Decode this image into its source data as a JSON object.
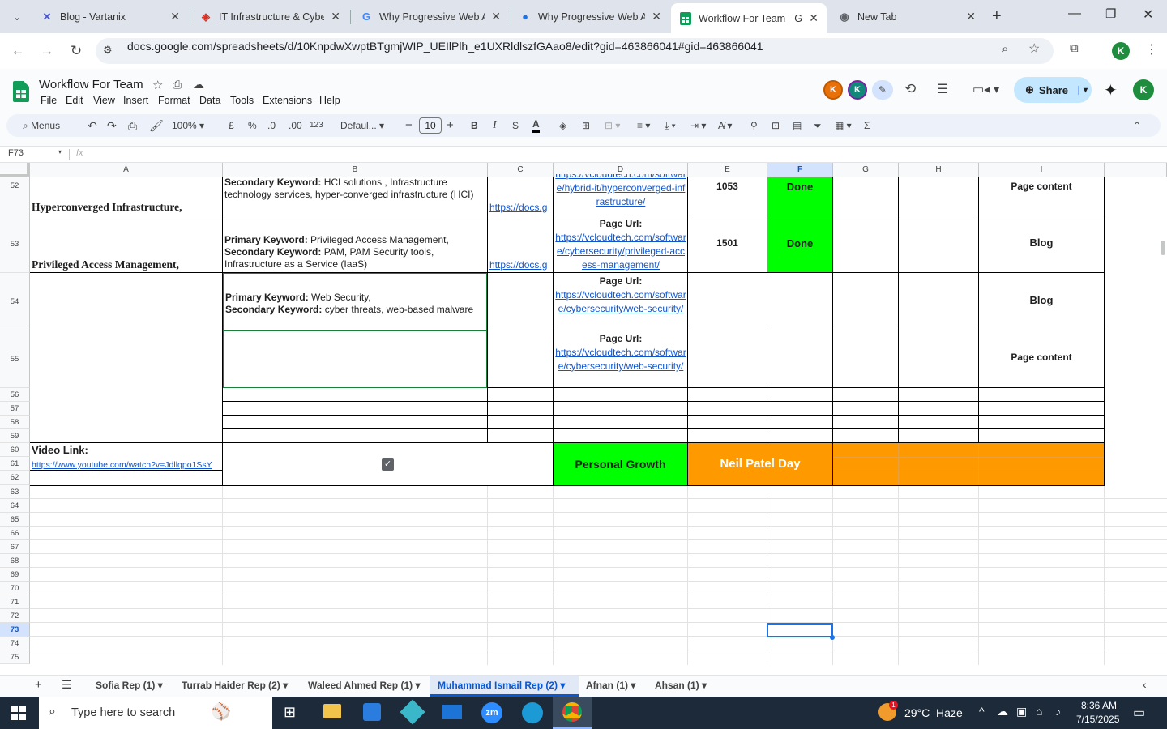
{
  "browser": {
    "tabs": [
      {
        "label": "Blog - Vartanix",
        "icon": "vartanix-icon",
        "color": "#4a56d8"
      },
      {
        "label": "IT Infrastructure & Cybe",
        "icon": "vcloud-icon",
        "color": "#d93025"
      },
      {
        "label": "Why Progressive Web A",
        "icon": "google-icon",
        "color": "#4285f4"
      },
      {
        "label": "Why Progressive Web A",
        "icon": "gemini-icon",
        "color": "#1a73e8"
      },
      {
        "label": "Workflow For Team - Go",
        "icon": "sheets-icon",
        "color": "#0f9d58",
        "active": true
      },
      {
        "label": "New Tab",
        "icon": "chrome-icon",
        "color": "#5f6368"
      }
    ],
    "url": "docs.google.com/spreadsheets/d/10KnpdwXwptBTgmjWIP_UEIlPlh_e1UXRldlszfGAao8/edit?gid=463866041#gid=463866041"
  },
  "sheets": {
    "title": "Workflow For Team",
    "menus": [
      "File",
      "Edit",
      "View",
      "Insert",
      "Format",
      "Data",
      "Tools",
      "Extensions",
      "Help"
    ],
    "share_label": "Share",
    "avatar_letter": "K",
    "toolbar": {
      "search": "Menus",
      "zoom": "100%",
      "currency": "£",
      "percent": "%",
      "dec_less": ".0",
      "dec_more": ".00",
      "numfmt": "123",
      "font": "Defaul...",
      "font_size": "10"
    },
    "name_box": "F73",
    "fx": "fx"
  },
  "columns": [
    "A",
    "B",
    "C",
    "D",
    "E",
    "F",
    "G",
    "H",
    "I"
  ],
  "row_numbers": [
    "52",
    "53",
    "54",
    "55",
    "56",
    "57",
    "58",
    "59",
    "60",
    "61",
    "62",
    "63",
    "64",
    "65",
    "66",
    "67",
    "68",
    "69",
    "70",
    "71",
    "72",
    "73",
    "74",
    "75"
  ],
  "rows": {
    "r52": {
      "a": "Hyperconverged Infrastructure,",
      "b_bold": "Secondary Keyword:",
      "b_text": " HCI solutions , Infrastructure technology services, hyper-converged infrastructure (HCI)",
      "c": "https://docs.g",
      "d": "https://vcloudtech.com/software/hybrid-it/hyperconverged-infrastructure/",
      "e": "1053",
      "f": "Done",
      "i": "Page content"
    },
    "r53": {
      "a": "Privileged Access Management,",
      "b_bold1": "Primary Keyword:",
      "b_text1": " Privileged Access Management,",
      "b_bold2": "Secondary Keyword:",
      "b_text2": " PAM, PAM Security tools, Infrastructure as a Service (IaaS)",
      "c": "https://docs.g",
      "d_label": "Page Url:",
      "d": "https://vcloudtech.com/software/cybersecurity/privileged-access-management/",
      "e": "1501",
      "f": "Done",
      "i": "Blog"
    },
    "r54": {
      "b_bold1": "Primary Keyword:",
      "b_text1": " Web Security,",
      "b_bold2": "Secondary Keyword:",
      "b_text2": " cyber threats, web-based malware",
      "d_label": "Page Url:",
      "d": "https://vcloudtech.com/software/cybersecurity/web-security/",
      "i": "Blog"
    },
    "r55": {
      "d_label": "Page Url:",
      "d": "https://vcloudtech.com/software/cybersecurity/web-security/",
      "i": "Page content"
    },
    "r60": {
      "a_label": "Video Link:",
      "a_link": "https://www.youtube.com/watch?v=Jdllqpo1SsY",
      "checkbox_checked": true,
      "d": "Personal Growth",
      "e": "Neil Patel Day"
    }
  },
  "colors": {
    "done_green": "#00ff00",
    "personal_growth_green": "#00ff00",
    "orange": "#ff9900",
    "selection_blue": "#1a73e8"
  },
  "sheet_tabs": [
    {
      "label": "Sofia Rep (1)"
    },
    {
      "label": "Turrab Haider Rep (2)"
    },
    {
      "label": "Waleed Ahmed Rep (1)"
    },
    {
      "label": "Muhammad Ismail Rep (2)",
      "active": true
    },
    {
      "label": "Afnan (1)"
    },
    {
      "label": "Ahsan (1)"
    }
  ],
  "taskbar": {
    "search_placeholder": "Type here to search",
    "weather": "29°C  Haze",
    "time": "8:36 AM",
    "date": "7/15/2025",
    "notif_badge": "1"
  }
}
